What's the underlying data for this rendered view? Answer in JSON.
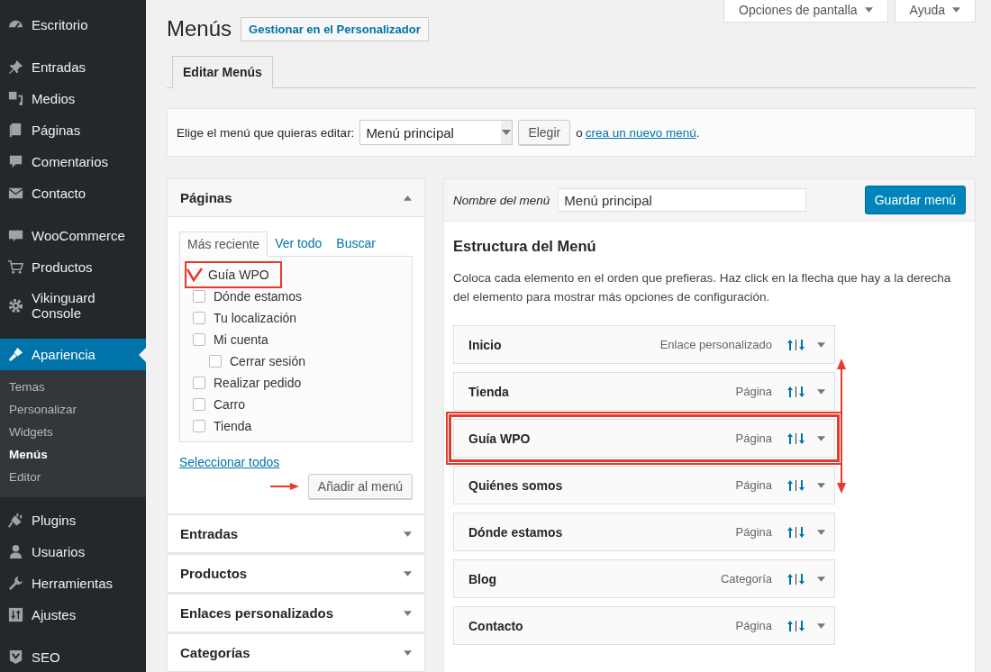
{
  "sidebar": {
    "groups": [
      [
        {
          "label": "Escritorio",
          "selected": false
        }
      ],
      [
        {
          "label": "Entradas",
          "selected": false
        },
        {
          "label": "Medios",
          "selected": false
        },
        {
          "label": "Páginas",
          "selected": false
        },
        {
          "label": "Comentarios",
          "selected": false
        },
        {
          "label": "Contacto",
          "selected": false
        }
      ],
      [
        {
          "label": "WooCommerce",
          "selected": false
        },
        {
          "label": "Productos",
          "selected": false
        },
        {
          "label": "Vikinguard Console",
          "selected": false
        }
      ],
      [
        {
          "label": "Apariencia",
          "selected": true,
          "children": [
            {
              "label": "Temas",
              "selected": false
            },
            {
              "label": "Personalizar",
              "selected": false
            },
            {
              "label": "Widgets",
              "selected": false
            },
            {
              "label": "Menús",
              "selected": true
            },
            {
              "label": "Editor",
              "selected": false
            }
          ]
        },
        {
          "label": "Plugins",
          "selected": false
        },
        {
          "label": "Usuarios",
          "selected": false
        },
        {
          "label": "Herramientas",
          "selected": false
        },
        {
          "label": "Ajustes",
          "selected": false
        }
      ],
      [
        {
          "label": "SEO",
          "selected": false
        }
      ]
    ]
  },
  "screen_tabs": [
    "Opciones de pantalla",
    "Ayuda"
  ],
  "page_title": "Menús",
  "title_action": "Gestionar en el Personalizador",
  "nav_tabs": [
    {
      "label": "Editar Menús",
      "selected": true
    }
  ],
  "menu_picker": {
    "label": "Elige el menú que quieras editar:",
    "value": "Menú principal",
    "button": "Elegir",
    "or_text": "o",
    "link": "crea un nuevo menú",
    "after": "."
  },
  "add_panels": [
    {
      "title": "Páginas",
      "expanded": true,
      "tabs": [
        {
          "label": "Más reciente",
          "selected": true
        },
        {
          "label": "Ver todo",
          "selected": false
        },
        {
          "label": "Buscar",
          "selected": false
        }
      ],
      "items": [
        {
          "label": "Guía WPO",
          "checked": true,
          "highlighted": true
        },
        {
          "label": "Dónde estamos",
          "checked": false,
          "highlighted": false
        },
        {
          "label": "Tu localización",
          "checked": false,
          "highlighted": false
        },
        {
          "label": "Mi cuenta",
          "checked": false,
          "highlighted": false,
          "children": [
            {
              "label": "Cerrar sesión",
              "checked": false,
              "highlighted": false
            }
          ]
        },
        {
          "label": "Realizar pedido",
          "checked": false,
          "highlighted": false
        },
        {
          "label": "Carro",
          "checked": false,
          "highlighted": false
        },
        {
          "label": "Tienda",
          "checked": false,
          "highlighted": false
        }
      ],
      "select_all": "Seleccionar todos",
      "add_button": "Añadir al menú"
    },
    {
      "title": "Entradas",
      "expanded": false
    },
    {
      "title": "Productos",
      "expanded": false
    },
    {
      "title": "Enlaces personalizados",
      "expanded": false
    },
    {
      "title": "Categorías",
      "expanded": false
    }
  ],
  "menu_editor": {
    "name_label": "Nombre del menú",
    "name_value": "Menú principal",
    "save_button": "Guardar menú",
    "heading": "Estructura del Menú",
    "description": "Coloca cada elemento en el orden que prefieras. Haz click en la flecha que hay a la derecha del elemento para mostrar más opciones de configuración.",
    "items": [
      {
        "title": "Inicio",
        "type": "Enlace personalizado",
        "highlighted": false
      },
      {
        "title": "Tienda",
        "type": "Página",
        "highlighted": false
      },
      {
        "title": "Guía WPO",
        "type": "Página",
        "highlighted": true
      },
      {
        "title": "Quiénes somos",
        "type": "Página",
        "highlighted": false
      },
      {
        "title": "Dónde estamos",
        "type": "Página",
        "highlighted": false
      },
      {
        "title": "Blog",
        "type": "Categoría",
        "highlighted": false
      },
      {
        "title": "Contacto",
        "type": "Página",
        "highlighted": false
      }
    ]
  }
}
